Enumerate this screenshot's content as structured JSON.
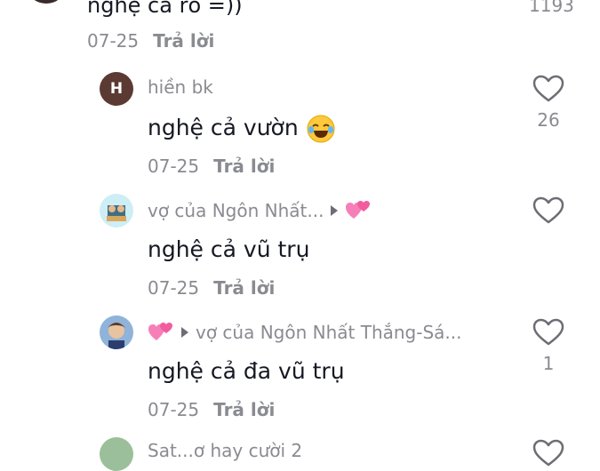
{
  "top_comment": {
    "text": "nghệ cả rổ =))",
    "likes": "1193",
    "date": "07-25",
    "reply": "Trả lời"
  },
  "replies": [
    {
      "avatar_letter": "H",
      "username": "hiền bk",
      "text": "nghệ cả vườn",
      "date": "07-25",
      "reply": "Trả lời",
      "likes": "26"
    },
    {
      "username": "vợ của Ngôn Nhất...",
      "text": "nghệ cả vũ trụ",
      "date": "07-25",
      "reply": "Trả lời",
      "likes": ""
    },
    {
      "username": "vợ của Ngôn Nhất Thắng-Sá...",
      "text": "nghệ cả đa vũ trụ",
      "date": "07-25",
      "reply": "Trả lời",
      "likes": "1"
    },
    {
      "username": "Sat...ơ hay cười 2"
    }
  ],
  "colors": {
    "text": "#161823",
    "muted": "#8a8b91",
    "heart_stroke": "#6d6e74",
    "pink": "#f25c9f"
  },
  "icons": [
    "heart-outline-icon",
    "laughing-emoji-icon",
    "two-hearts-emoji-icon",
    "play-triangle-icon"
  ]
}
